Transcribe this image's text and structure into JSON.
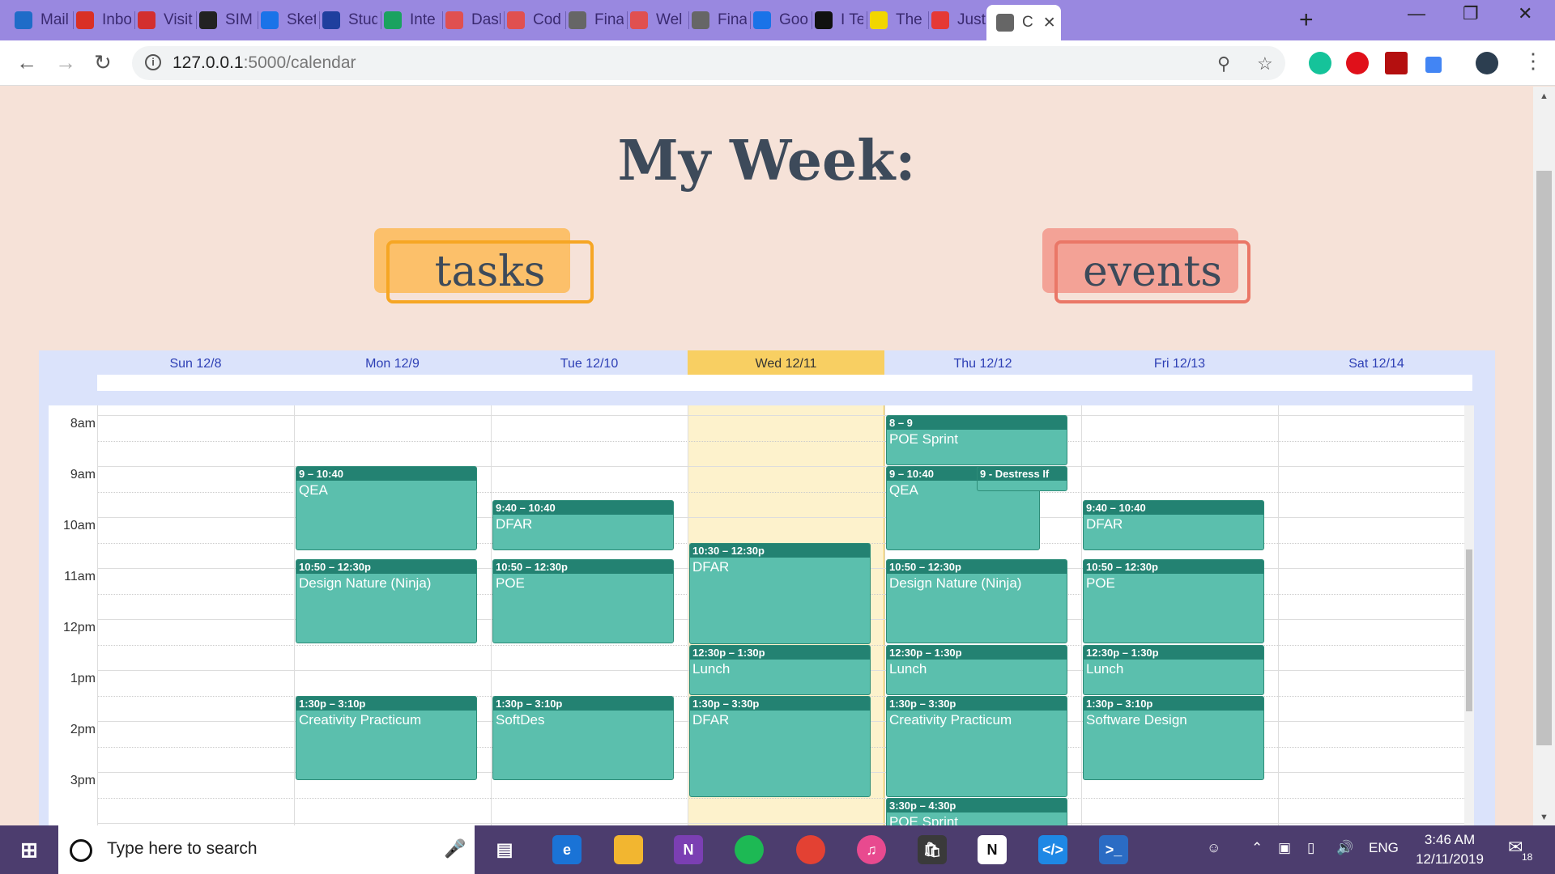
{
  "browser": {
    "tabs": [
      {
        "label": "Mail",
        "icon": "outlook-icon",
        "color": "#1f6cc8"
      },
      {
        "label": "Inbox",
        "icon": "gmail-icon",
        "color": "#d93025"
      },
      {
        "label": "Visit",
        "icon": "pdf-icon",
        "color": "#d32f2f"
      },
      {
        "label": "SIM",
        "icon": "sim-icon",
        "color": "#222222"
      },
      {
        "label": "Sketch",
        "icon": "sketch-icon",
        "color": "#1a73e8"
      },
      {
        "label": "Stud",
        "icon": "m-icon",
        "color": "#1f3f9e"
      },
      {
        "label": "Inte",
        "icon": "code-icon",
        "color": "#1aa260"
      },
      {
        "label": "Dash",
        "icon": "dashboard-icon",
        "color": "#e05050"
      },
      {
        "label": "Cod",
        "icon": "dashboard-icon",
        "color": "#e05050"
      },
      {
        "label": "Fina",
        "icon": "globe-icon",
        "color": "#666666"
      },
      {
        "label": "Wel",
        "icon": "dashboard-icon",
        "color": "#e05050"
      },
      {
        "label": "Fina",
        "icon": "globe-icon",
        "color": "#666666"
      },
      {
        "label": "Goo",
        "icon": "calendar-icon",
        "color": "#1a73e8"
      },
      {
        "label": "I Tec",
        "icon": "nyt-icon",
        "color": "#111111"
      },
      {
        "label": "The",
        "icon": "v-icon",
        "color": "#f2d600"
      },
      {
        "label": "Just",
        "icon": "chart-icon",
        "color": "#e53935"
      },
      {
        "label": "C",
        "icon": "globe-icon",
        "color": "#666666"
      }
    ],
    "url_host": "127.0.0.1",
    "url_path": ":5000/calendar"
  },
  "page": {
    "title": "My Week:",
    "tasks_label": "tasks",
    "events_label": "events"
  },
  "calendar": {
    "days": [
      "Sun 12/8",
      "Mon 12/9",
      "Tue 12/10",
      "Wed 12/11",
      "Thu 12/12",
      "Fri 12/13",
      "Sat 12/14"
    ],
    "today_index": 3,
    "hours": [
      "8am",
      "9am",
      "10am",
      "11am",
      "12pm",
      "1pm",
      "2pm",
      "3pm"
    ],
    "events": [
      {
        "day": 4,
        "start": 8.0,
        "end": 9.0,
        "time": "8 – 9",
        "name": "POE Sprint"
      },
      {
        "day": 1,
        "start": 9.0,
        "end": 10.667,
        "time": "9 – 10:40",
        "name": "QEA"
      },
      {
        "day": 4,
        "start": 9.0,
        "end": 10.667,
        "time": "9 – 10:40",
        "name": "QEA",
        "narrow": true
      },
      {
        "day": 4,
        "start": 9.0,
        "end": 9.5,
        "time": "9 - Destress If",
        "name": "",
        "overlay": true
      },
      {
        "day": 2,
        "start": 9.667,
        "end": 10.667,
        "time": "9:40 – 10:40",
        "name": "DFAR"
      },
      {
        "day": 5,
        "start": 9.667,
        "end": 10.667,
        "time": "9:40 – 10:40",
        "name": "DFAR"
      },
      {
        "day": 3,
        "start": 10.5,
        "end": 12.5,
        "time": "10:30 – 12:30p",
        "name": "DFAR"
      },
      {
        "day": 1,
        "start": 10.833,
        "end": 12.5,
        "time": "10:50 – 12:30p",
        "name": "Design Nature (Ninja)"
      },
      {
        "day": 2,
        "start": 10.833,
        "end": 12.5,
        "time": "10:50 – 12:30p",
        "name": "POE"
      },
      {
        "day": 4,
        "start": 10.833,
        "end": 12.5,
        "time": "10:50 – 12:30p",
        "name": "Design Nature (Ninja)"
      },
      {
        "day": 5,
        "start": 10.833,
        "end": 12.5,
        "time": "10:50 – 12:30p",
        "name": "POE"
      },
      {
        "day": 3,
        "start": 12.5,
        "end": 13.5,
        "time": "12:30p – 1:30p",
        "name": "Lunch"
      },
      {
        "day": 4,
        "start": 12.5,
        "end": 13.5,
        "time": "12:30p – 1:30p",
        "name": "Lunch"
      },
      {
        "day": 5,
        "start": 12.5,
        "end": 13.5,
        "time": "12:30p – 1:30p",
        "name": "Lunch"
      },
      {
        "day": 1,
        "start": 13.5,
        "end": 15.167,
        "time": "1:30p – 3:10p",
        "name": "Creativity Practicum"
      },
      {
        "day": 2,
        "start": 13.5,
        "end": 15.167,
        "time": "1:30p – 3:10p",
        "name": "SoftDes"
      },
      {
        "day": 3,
        "start": 13.5,
        "end": 15.5,
        "time": "1:30p – 3:30p",
        "name": "DFAR"
      },
      {
        "day": 4,
        "start": 13.5,
        "end": 15.5,
        "time": "1:30p – 3:30p",
        "name": "Creativity Practicum"
      },
      {
        "day": 5,
        "start": 13.5,
        "end": 15.167,
        "time": "1:30p – 3:10p",
        "name": "Software Design"
      },
      {
        "day": 4,
        "start": 15.5,
        "end": 16.5,
        "time": "3:30p – 4:30p",
        "name": "POE Sprint"
      }
    ]
  },
  "taskbar": {
    "search_placeholder": "Type here to search",
    "lang": "ENG",
    "time": "3:46 AM",
    "date": "12/11/2019",
    "notifications": "18"
  }
}
